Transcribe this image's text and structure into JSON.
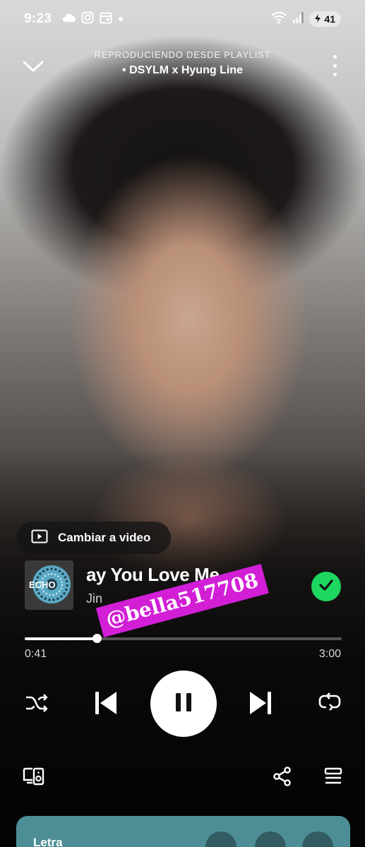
{
  "status_bar": {
    "time": "9:23",
    "battery": "41",
    "icons": [
      "cloud-icon",
      "instagram-icon",
      "calendar-icon",
      "dot-icon",
      "wifi-icon",
      "signal-icon",
      "battery-icon"
    ]
  },
  "header": {
    "context_label": "REPRODUCIENDO DESDE PLAYLIST",
    "playlist_name": "• DSYLM x Hyung Line"
  },
  "video_switch": {
    "label": "Cambiar a video"
  },
  "track": {
    "title": "ay You Love Me",
    "artist": "Jin",
    "cover_text": "ECHO",
    "saved": true
  },
  "watermark": "@bella517708",
  "playback": {
    "elapsed": "0:41",
    "total": "3:00",
    "progress": 0.228
  },
  "lyrics": {
    "title": "Letra"
  },
  "colors": {
    "accent_green": "#1ed760",
    "lyrics_card": "#4d8e96",
    "watermark_bg": "#d21fd6"
  }
}
